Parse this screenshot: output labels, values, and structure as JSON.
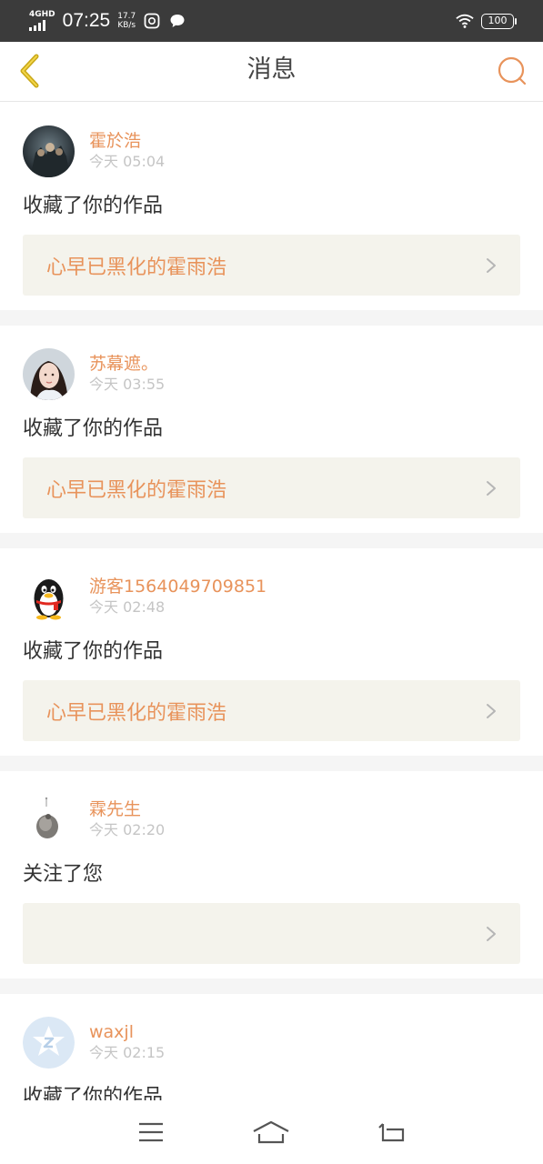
{
  "status_bar": {
    "network": "4GHD",
    "time": "07:25",
    "speed_value": "17.7",
    "speed_unit": "KB/s",
    "battery": "100"
  },
  "header": {
    "title": "消息"
  },
  "messages": [
    {
      "name": "霍於浩",
      "time": "今天 05:04",
      "action": "收藏了你的作品",
      "work": "心早已黑化的霍雨浩",
      "avatar": "dark-movie-avatar"
    },
    {
      "name": "苏幕遮。",
      "time": "今天 03:55",
      "action": "收藏了你的作品",
      "work": "心早已黑化的霍雨浩",
      "avatar": "girl-portrait-avatar"
    },
    {
      "name": "游客1564049709851",
      "time": "今天 02:48",
      "action": "收藏了你的作品",
      "work": "心早已黑化的霍雨浩",
      "avatar": "qq-penguin-avatar"
    },
    {
      "name": "霖先生",
      "time": "今天 02:20",
      "action": "关注了您",
      "work": "",
      "avatar": "small-bird-avatar"
    },
    {
      "name": "waxjl",
      "time": "今天 02:15",
      "action": "收藏了你的作品",
      "work": "",
      "avatar": "blue-default-avatar"
    }
  ],
  "colors": {
    "accent": "#e8935b",
    "card_bg": "#f4f3ec",
    "status_bar": "#3b3b3b"
  }
}
